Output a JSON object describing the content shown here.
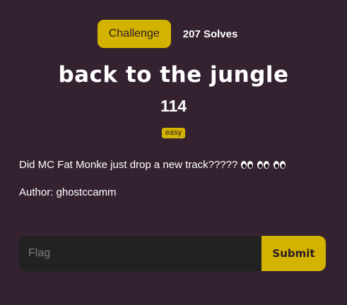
{
  "tabs": {
    "challenge": "Challenge",
    "solves": "207 Solves"
  },
  "challenge": {
    "name": "back to the jungle",
    "points": "114",
    "tag": "easy",
    "description": "Did MC Fat Monke just drop a new track?????",
    "description_emoji": [
      "eyes-emoji",
      "eyes-emoji",
      "eyes-emoji"
    ],
    "author": "Author: ghostccamm"
  },
  "form": {
    "flag_placeholder": "Flag",
    "flag_value": "",
    "submit_label": "Submit"
  },
  "colors": {
    "background": "#342231",
    "accent": "#d4b300",
    "input_bg": "#222222"
  }
}
